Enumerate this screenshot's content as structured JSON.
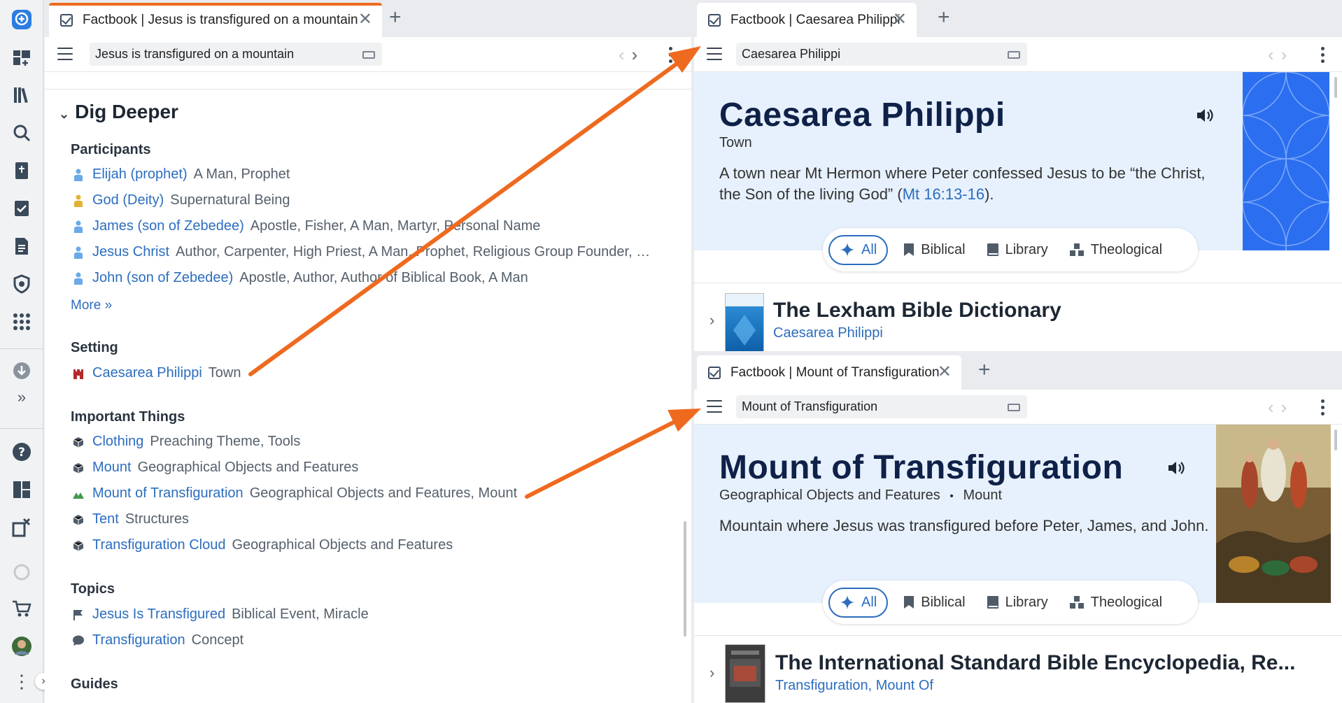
{
  "left_panel": {
    "tab": {
      "title": "Factbook | Jesus is transfigured on a mountain"
    },
    "address": "Jesus is transfigured on a mountain",
    "section_title": "Dig Deeper",
    "participants": {
      "heading": "Participants",
      "items": [
        {
          "link": "Elijah (prophet)",
          "desc": "A Man, Prophet",
          "icon": "person-icon",
          "color": "#6aaae8"
        },
        {
          "link": "God (Deity)",
          "desc": "Supernatural Being",
          "icon": "person-icon",
          "color": "#e0b23a"
        },
        {
          "link": "James (son of Zebedee)",
          "desc": "Apostle, Fisher, A Man, Martyr, Personal Name",
          "icon": "person-icon",
          "color": "#6aaae8"
        },
        {
          "link": "Jesus Christ",
          "desc": "Author, Carpenter, High Priest, A Man, Prophet, Religious Group Founder, …",
          "icon": "person-icon",
          "color": "#6aaae8"
        },
        {
          "link": "John (son of Zebedee)",
          "desc": "Apostle, Author, Author of Biblical Book, A Man",
          "icon": "person-icon",
          "color": "#6aaae8"
        }
      ],
      "more": "More »"
    },
    "setting": {
      "heading": "Setting",
      "items": [
        {
          "link": "Caesarea Philippi",
          "desc": "Town",
          "icon": "castle-icon",
          "color": "#b52a2a"
        }
      ]
    },
    "things": {
      "heading": "Important Things",
      "items": [
        {
          "link": "Clothing",
          "desc": "Preaching Theme, Tools",
          "icon": "cube-icon"
        },
        {
          "link": "Mount",
          "desc": "Geographical Objects and Features",
          "icon": "cube-icon"
        },
        {
          "link": "Mount of Transfiguration",
          "desc": "Geographical Objects and Features, Mount",
          "icon": "mountain-icon"
        },
        {
          "link": "Tent",
          "desc": "Structures",
          "icon": "cube-icon"
        },
        {
          "link": "Transfiguration Cloud",
          "desc": "Geographical Objects and Features",
          "icon": "cube-icon"
        }
      ]
    },
    "topics": {
      "heading": "Topics",
      "items": [
        {
          "link": "Jesus Is Transfigured",
          "desc": "Biblical Event, Miracle",
          "icon": "flag-icon"
        },
        {
          "link": "Transfiguration",
          "desc": "Concept",
          "icon": "speech-bubble-icon"
        }
      ]
    },
    "guides_heading": "Guides"
  },
  "top_right": {
    "tab": {
      "title": "Factbook | Caesarea Philippi"
    },
    "address": "Caesarea Philippi",
    "title": "Caesarea Philippi",
    "subtitle": "Town",
    "description": "A town near Mt Hermon where Peter confessed Jesus to be “the Christ, the Son of the living God” (",
    "reference": "Mt 16:13-16",
    "description_end": ").",
    "accent_color": "#2b6ff0",
    "resource": {
      "title": "The Lexham Bible Dictionary",
      "subtitle": "Caesarea Philippi"
    }
  },
  "bottom_right": {
    "tab": {
      "title": "Factbook | Mount of Transfiguration"
    },
    "address": "Mount of Transfiguration",
    "title": "Mount of Transfiguration",
    "subtitle_a": "Geographical Objects and Features",
    "subtitle_sep": "•",
    "subtitle_b": "Mount",
    "description": "Mountain where Jesus was transfigured before Peter, James, and John.",
    "resource": {
      "title": "The International Standard Bible Encyclopedia, Re...",
      "subtitle": "Transfiguration, Mount Of"
    }
  },
  "filters": {
    "all": "All",
    "biblical": "Biblical",
    "library": "Library",
    "theological": "Theological"
  },
  "colors": {
    "link": "#2c6dbf",
    "arrow": "#ee6a1f",
    "hero_bg": "#e7f1fd",
    "title": "#0f2148"
  }
}
